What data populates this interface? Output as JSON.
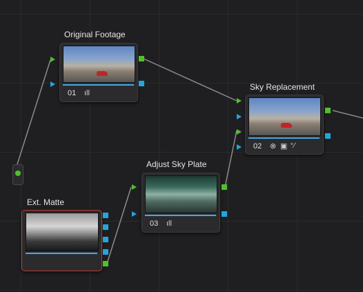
{
  "colors": {
    "input_port": "#4ec12c",
    "alpha_port": "#22a6e0",
    "selected_border": "#c0392b",
    "node_bg": "#2b2b2e"
  },
  "nodes": {
    "original_footage": {
      "title": "Original Footage",
      "number": "01",
      "icon": "bar-graph-icon"
    },
    "sky_replacement": {
      "title": "Sky Replacement",
      "number": "02",
      "icons": [
        "mask-icon",
        "key-icon",
        "magic-wand-icon"
      ]
    },
    "adjust_sky_plate": {
      "title": "Adjust Sky Plate",
      "number": "03",
      "icon": "bar-graph-icon"
    },
    "ext_matte": {
      "title": "Ext. Matte"
    }
  },
  "glyphs": {
    "bars": "ıll",
    "mask": "⊗",
    "key": "▣",
    "wand": "⁺⁄"
  }
}
